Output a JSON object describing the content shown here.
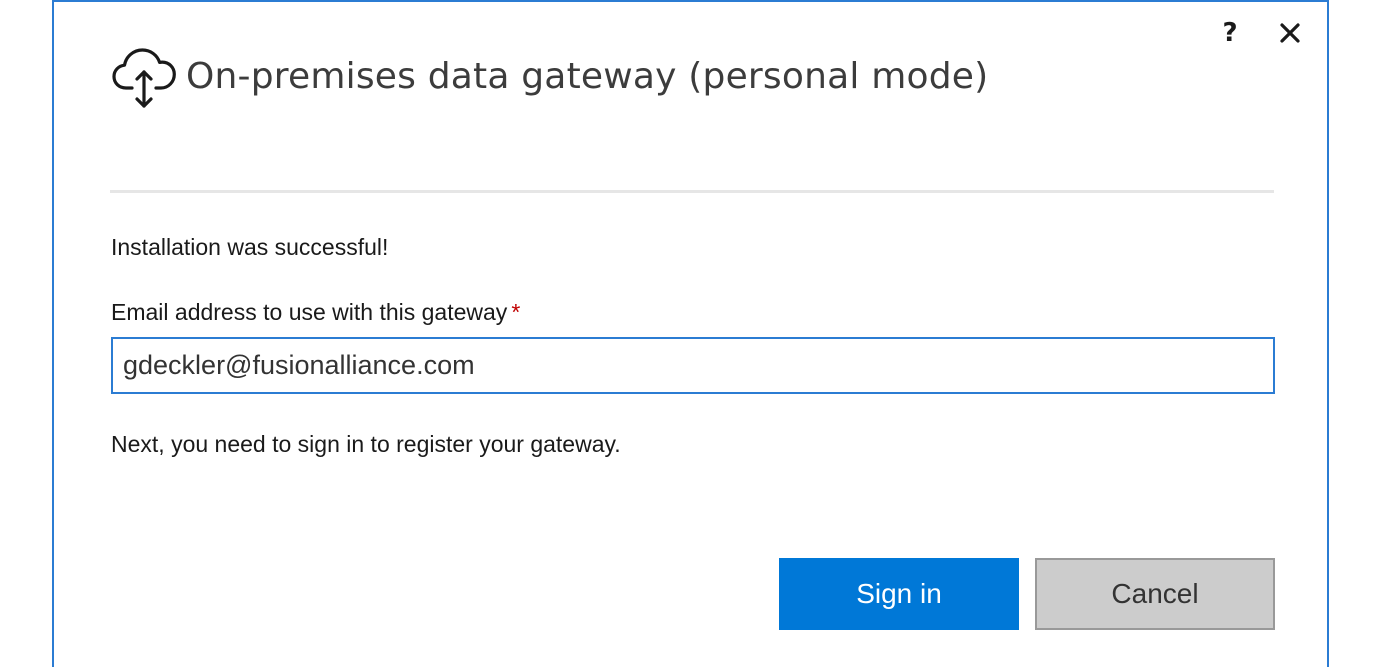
{
  "window": {
    "title": "On-premises data gateway (personal mode)",
    "help_icon": "help-icon",
    "close_icon": "close-icon",
    "app_icon": "cloud-upload-download-icon",
    "accent_color": "#2b7cd3"
  },
  "body": {
    "status_message": "Installation was successful!",
    "email_label": "Email address to use with this gateway",
    "required_marker": "*",
    "email_value": "gdeckler@fusionalliance.com",
    "hint": "Next, you need to sign in to register your gateway."
  },
  "buttons": {
    "sign_in_label": "Sign in",
    "cancel_label": "Cancel",
    "primary_color": "#0078d7"
  }
}
